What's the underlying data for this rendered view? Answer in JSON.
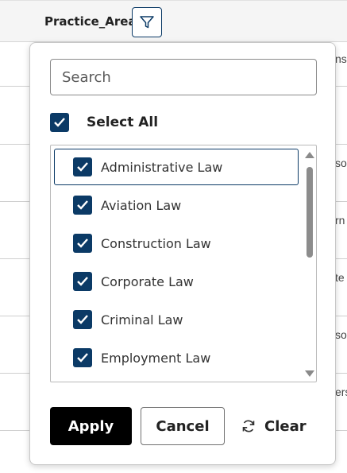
{
  "table": {
    "column_title": "Practice_Area",
    "row_fragments": [
      "ns",
      "so",
      "rn",
      "te",
      "so",
      "ers"
    ]
  },
  "filter_popup": {
    "search_placeholder": "Search",
    "select_all_label": "Select All",
    "select_all_checked": true,
    "items": [
      {
        "label": "Administrative Law",
        "checked": true,
        "focused": true
      },
      {
        "label": "Aviation Law",
        "checked": true
      },
      {
        "label": "Construction Law",
        "checked": true
      },
      {
        "label": "Corporate Law",
        "checked": true
      },
      {
        "label": "Criminal Law",
        "checked": true
      },
      {
        "label": "Employment Law",
        "checked": true
      }
    ],
    "buttons": {
      "apply": "Apply",
      "cancel": "Cancel",
      "clear": "Clear"
    }
  },
  "colors": {
    "accent": "#0b3a66",
    "apply_bg": "#000000"
  }
}
